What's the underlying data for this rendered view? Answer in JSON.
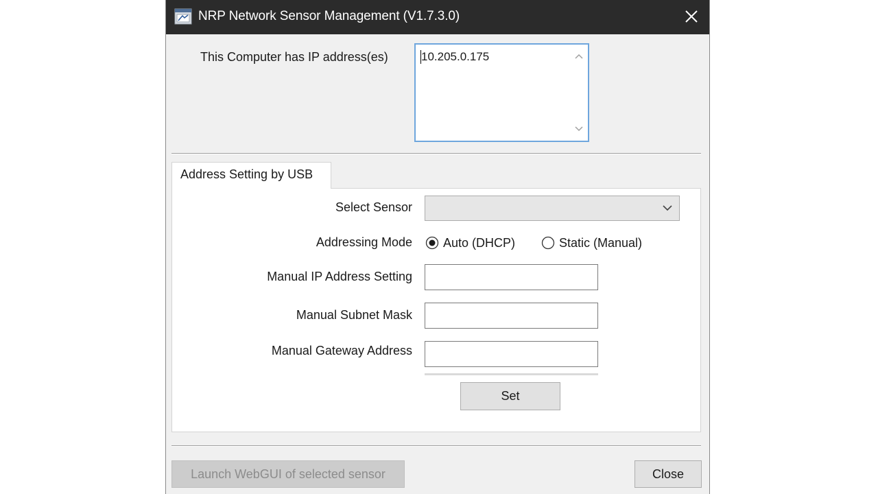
{
  "window": {
    "title": "NRP Network Sensor Management (V1.7.3.0)"
  },
  "ip_section": {
    "label": "This Computer has IP address(es)",
    "addresses": "10.205.0.175"
  },
  "tab": {
    "label": "Address Setting by USB"
  },
  "form": {
    "select_sensor_label": "Select Sensor",
    "select_sensor_value": "",
    "addressing_mode_label": "Addressing Mode",
    "mode_options": [
      "Auto (DHCP)",
      "Static (Manual)"
    ],
    "mode_selected": "Auto (DHCP)",
    "manual_ip_label": "Manual IP Address Setting",
    "manual_ip_value": "",
    "subnet_label": "Manual Subnet Mask",
    "subnet_value": "",
    "gateway_label": "Manual Gateway Address",
    "gateway_value": "",
    "set_button": "Set"
  },
  "footer": {
    "launch_button": "Launch WebGUI of selected sensor",
    "close_button": "Close"
  },
  "icons": {
    "app": "app-window-icon",
    "close": "close-icon",
    "scroll_up": "chevron-up-icon",
    "scroll_down": "chevron-down-icon",
    "dropdown": "chevron-down-icon"
  },
  "colors": {
    "titlebar": "#2b2b2b",
    "focus_border": "#6ea6dd",
    "window_bg": "#f0f0f0"
  }
}
